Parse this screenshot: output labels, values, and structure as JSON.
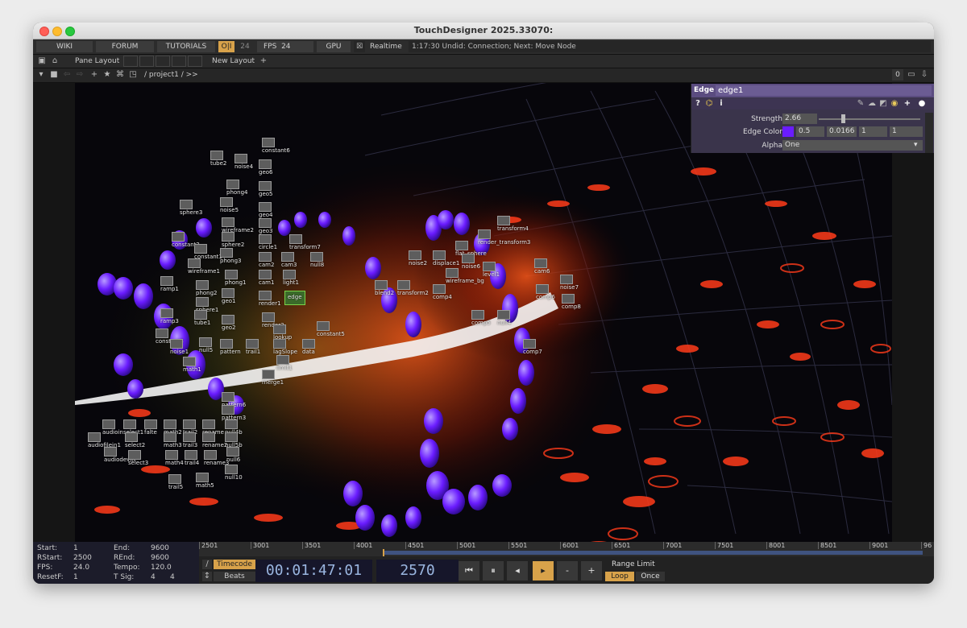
{
  "window": {
    "title": "TouchDesigner 2025.33070:"
  },
  "menubar": {
    "wiki": "WIKI",
    "forum": "FORUM",
    "tutorials": "TUTORIALS",
    "oi": "O|I",
    "oi_value": "24",
    "fps_label": "FPS",
    "fps_value": "24",
    "gpu": "GPU",
    "realtime_label": "Realtime",
    "status_log": "1:17:30 Undid: Connection; Next: Move Node"
  },
  "panebar": {
    "pane_layout": "Pane Layout",
    "new_layout": "New Layout",
    "add": "+"
  },
  "pathbar": {
    "path": "/ project1 / >>",
    "counter": "0"
  },
  "params": {
    "op_type": "Edge",
    "op_name": "edge1",
    "strength_label": "Strength",
    "strength_value": "2.66",
    "edgecolor_label": "Edge Color",
    "edgecolor_r": "0.5",
    "edgecolor_g": "0.0166",
    "edgecolor_b": "1",
    "edgecolor_a": "1",
    "edgecolor_swatch": "#6a1cff",
    "alpha_label": "Alpha",
    "alpha_value": "One"
  },
  "nodes": [
    {
      "label": "constant6"
    },
    {
      "label": "tube2"
    },
    {
      "label": "noise4"
    },
    {
      "label": "geo6"
    },
    {
      "label": "phong4"
    },
    {
      "label": "geo5"
    },
    {
      "label": "sphere3"
    },
    {
      "label": "noise5"
    },
    {
      "label": "geo4"
    },
    {
      "label": "wireframe2"
    },
    {
      "label": "geo3"
    },
    {
      "label": "constant2"
    },
    {
      "label": "sphere2"
    },
    {
      "label": "circle1"
    },
    {
      "label": "transform7"
    },
    {
      "label": "constant1"
    },
    {
      "label": "phong3"
    },
    {
      "label": "cam2"
    },
    {
      "label": "cam3"
    },
    {
      "label": "null8"
    },
    {
      "label": "wireframe1"
    },
    {
      "label": "cam1"
    },
    {
      "label": "light1"
    },
    {
      "label": "phong1"
    },
    {
      "label": "ramp1"
    },
    {
      "label": "phong2"
    },
    {
      "label": "geo1"
    },
    {
      "label": "edge"
    },
    {
      "label": "render1"
    },
    {
      "label": "sphere1"
    },
    {
      "label": "ramp3"
    },
    {
      "label": "tube1"
    },
    {
      "label": "geo2"
    },
    {
      "label": "render3"
    },
    {
      "label": "constant5"
    },
    {
      "label": "constant3"
    },
    {
      "label": "noise1"
    },
    {
      "label": "null5"
    },
    {
      "label": "pattern"
    },
    {
      "label": "trail1"
    },
    {
      "label": "lagSlope"
    },
    {
      "label": "lookup"
    },
    {
      "label": "data"
    },
    {
      "label": "math1"
    },
    {
      "label": "limit1"
    },
    {
      "label": "merge1"
    },
    {
      "label": "pattern6"
    },
    {
      "label": "pattern3"
    },
    {
      "label": "flat_sphere"
    },
    {
      "label": "transform4"
    },
    {
      "label": "render_transform3"
    },
    {
      "label": "noise2"
    },
    {
      "label": "displace1"
    },
    {
      "label": "noise6"
    },
    {
      "label": "level1"
    },
    {
      "label": "cam6"
    },
    {
      "label": "noise7"
    },
    {
      "label": "wireframe_bg"
    },
    {
      "label": "blend2"
    },
    {
      "label": "transform2"
    },
    {
      "label": "comp4"
    },
    {
      "label": "comp5"
    },
    {
      "label": "comp8"
    },
    {
      "label": "comp6"
    },
    {
      "label": "null4"
    },
    {
      "label": "comp7"
    },
    {
      "label": "audioin"
    },
    {
      "label": "select1"
    },
    {
      "label": "falte"
    },
    {
      "label": "math2"
    },
    {
      "label": "trail2"
    },
    {
      "label": "rename"
    },
    {
      "label": "null4b"
    },
    {
      "label": "audiofilein1"
    },
    {
      "label": "select2"
    },
    {
      "label": "math3"
    },
    {
      "label": "trail3"
    },
    {
      "label": "rename2"
    },
    {
      "label": "null5b"
    },
    {
      "label": "audiodevin"
    },
    {
      "label": "select3"
    },
    {
      "label": "math4"
    },
    {
      "label": "trail4"
    },
    {
      "label": "rename3"
    },
    {
      "label": "null6"
    },
    {
      "label": "null10"
    },
    {
      "label": "trail5"
    },
    {
      "label": "math5"
    }
  ],
  "range": {
    "start_label": "Start:",
    "start": "1",
    "end_label": "End:",
    "end": "9600",
    "rstart_label": "RStart:",
    "rstart": "2500",
    "rend_label": "REnd:",
    "rend": "9600",
    "fps_label": "FPS:",
    "fps": "24.0",
    "tempo_label": "Tempo:",
    "tempo": "120.0",
    "resetf_label": "ResetF:",
    "resetf": "1",
    "tsig_label": "T Sig:",
    "tsig_a": "4",
    "tsig_b": "4"
  },
  "ruler": {
    "ticks": [
      "2501",
      "3001",
      "3501",
      "4001",
      "4501",
      "5001",
      "5501",
      "6001",
      "6501",
      "7001",
      "7501",
      "8001",
      "8501",
      "9001",
      "96"
    ]
  },
  "timeline": {
    "timecode_btn": "Timecode",
    "beats_btn": "Beats",
    "timecode": "00:01:47:01",
    "frame": "2570",
    "range_limit": "Range Limit",
    "loop": "Loop",
    "once": "Once"
  },
  "colors": {
    "accent": "#d8a24a",
    "param_header": "#5b4c80",
    "viz_purple": "#6a1cff",
    "viz_red": "#ff3b1a"
  }
}
